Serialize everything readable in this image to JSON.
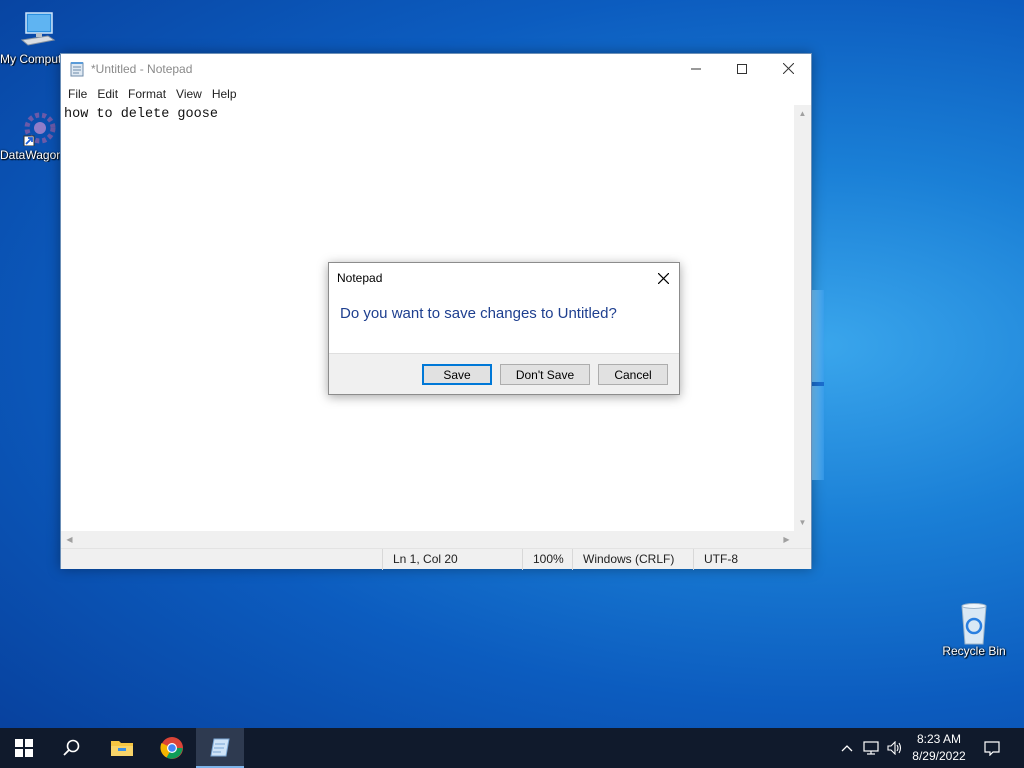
{
  "desktop": {
    "icons": [
      {
        "label": "My Computer",
        "icon": "computer-icon"
      },
      {
        "label": "DataWagon",
        "icon": "datawagon-icon"
      },
      {
        "label": "Recycle Bin",
        "icon": "recycle-bin-icon"
      }
    ]
  },
  "notepad": {
    "title": "*Untitled - Notepad",
    "menu": [
      "File",
      "Edit",
      "Format",
      "View",
      "Help"
    ],
    "content": "how to delete goose",
    "status": {
      "position": "Ln 1, Col 20",
      "zoom": "100%",
      "line_ending": "Windows (CRLF)",
      "encoding": "UTF-8"
    }
  },
  "dialog": {
    "title": "Notepad",
    "message": "Do you want to save changes to Untitled?",
    "buttons": {
      "save": "Save",
      "dont_save": "Don't Save",
      "cancel": "Cancel"
    }
  },
  "taskbar": {
    "apps": [
      "start-icon",
      "search-icon",
      "file-explorer-icon",
      "chrome-icon",
      "notepad-icon"
    ],
    "time": "8:23 AM",
    "date": "8/29/2022"
  },
  "colors": {
    "accent": "#0078d7",
    "dialog_message": "#1e3f8f",
    "taskbar": "#101a2c"
  }
}
